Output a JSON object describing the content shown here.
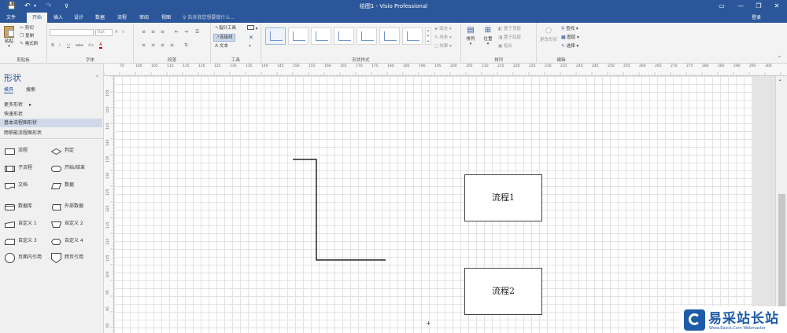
{
  "app": {
    "title": "绘图1 - Visio Professional",
    "login": "登录"
  },
  "titlebar": {
    "save_glyph": "💾",
    "undo_glyph": "↶",
    "redo_glyph": "↷",
    "customize_glyph": "⊽",
    "minimize_glyph": "—",
    "restore_glyph": "❐",
    "close_glyph": "✕",
    "ribbon_opts_glyph": "▭"
  },
  "tabs": [
    "文件",
    "开始",
    "插入",
    "设计",
    "数据",
    "流程",
    "审阅",
    "视图"
  ],
  "tell_me": "告诉我您想要做什么...",
  "ribbon": {
    "clipboard": {
      "label": "剪贴板",
      "paste": "粘贴",
      "cut": "剪切",
      "copy": "复制",
      "format_painter": "格式刷"
    },
    "font": {
      "label": "字体",
      "font_size": "8pt",
      "bold": "B",
      "italic": "I",
      "underline": "U",
      "strike": "abc",
      "case": "Aa",
      "grow": "A",
      "shrink": "A",
      "color": "A"
    },
    "paragraph": {
      "label": "段落"
    },
    "tools": {
      "label": "工具",
      "pointer": "指针工具",
      "connector": "连接线",
      "text": "文本"
    },
    "shape_styles": {
      "label": "形状样式",
      "fill": "填充",
      "line": "线条",
      "effects": "效果"
    },
    "arrange": {
      "label": "排列",
      "align": "排列",
      "position": "位置",
      "bring_front": "置于顶层",
      "send_back": "置于底层",
      "group": "组合"
    },
    "editing": {
      "label": "编辑",
      "change_shape": "更改形状",
      "find": "查找",
      "layers": "图层",
      "select": "选择"
    }
  },
  "shapes_pane": {
    "title": "形状",
    "collapse": "‹",
    "tab_stencils": "模具",
    "tab_search": "搜索",
    "more_shapes": "更多形状",
    "quick_shapes": "快速形状",
    "basic_flowchart": "基本流程图形状",
    "cross_functional": "跨职能流程图形状",
    "stencils": [
      "流程",
      "判定",
      "子流程",
      "开始/结束",
      "文档",
      "数据",
      "数据库",
      "外部数据",
      "自定义 1",
      "自定义 2",
      "自定义 3",
      "自定义 4",
      "页面内引用",
      "跨页引用"
    ]
  },
  "ruler": {
    "h_ticks": [
      "70",
      "100",
      "105",
      "110",
      "115",
      "120",
      "125",
      "130",
      "135",
      "140",
      "145",
      "150",
      "155",
      "160",
      "165",
      "170",
      "175",
      "180",
      "185",
      "190",
      "195",
      "200",
      "205",
      "210",
      "215",
      "220",
      "225",
      "230",
      "235",
      "240",
      "245",
      "250",
      "255",
      "260",
      "265",
      "270",
      "275",
      "280",
      "285",
      "290",
      "295",
      "300"
    ],
    "v_ticks": [
      "155",
      "150",
      "145",
      "140",
      "135",
      "130",
      "125",
      "120",
      "115",
      "110",
      "105",
      "100",
      "95",
      "90",
      "85"
    ]
  },
  "canvas": {
    "box1": "流程1",
    "box2": "流程2"
  },
  "watermark": {
    "cn": "易采站长站",
    "en": "Www.Easck.Com Webmaster"
  },
  "colors": {
    "accent": "#2b579a",
    "watermark": "#1e5ba8"
  }
}
